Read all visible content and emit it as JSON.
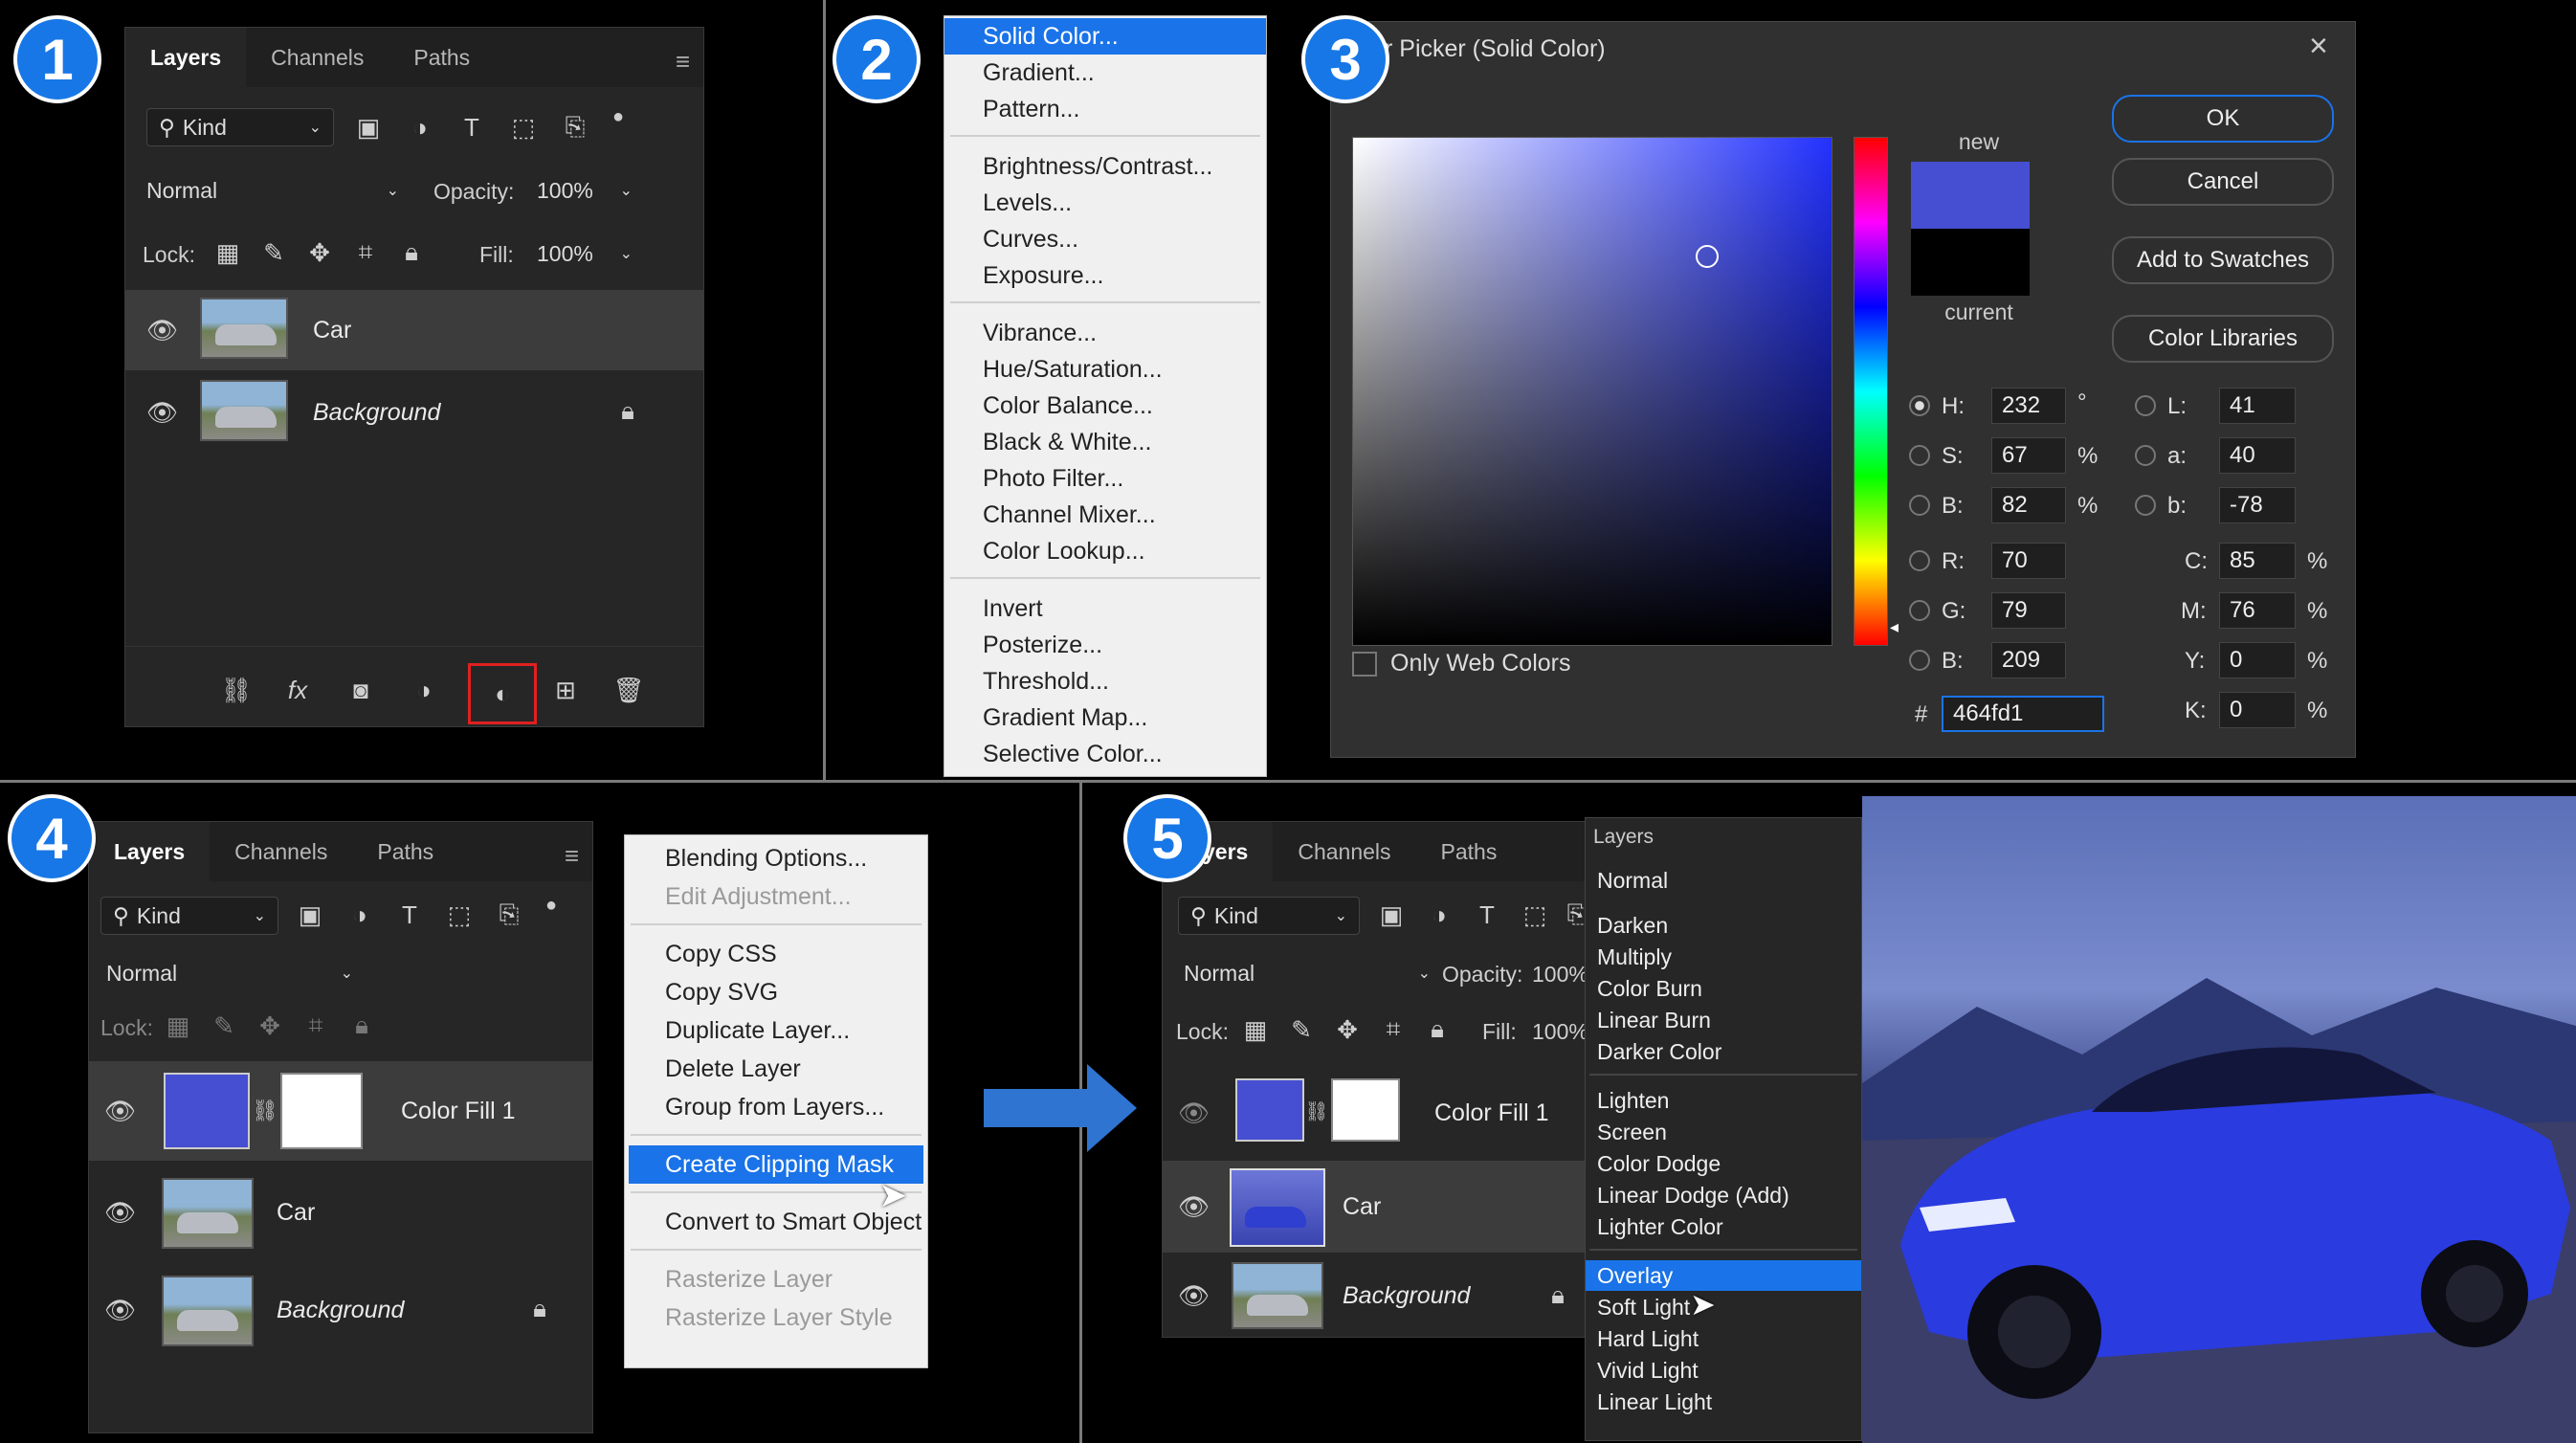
{
  "steps": [
    "1",
    "2",
    "3",
    "4",
    "5"
  ],
  "tabs": {
    "layers": "Layers",
    "channels": "Channels",
    "paths": "Paths"
  },
  "panel": {
    "kind": "Kind",
    "blend": "Normal",
    "opacity_label": "Opacity:",
    "opacity": "100%",
    "lock_label": "Lock:",
    "fill_label": "Fill:",
    "fill": "100%"
  },
  "p1_layers": [
    {
      "name": "Car"
    },
    {
      "name": "Background"
    }
  ],
  "adjust_menu": {
    "groups": [
      [
        "Solid Color...",
        "Gradient...",
        "Pattern..."
      ],
      [
        "Brightness/Contrast...",
        "Levels...",
        "Curves...",
        "Exposure..."
      ],
      [
        "Vibrance...",
        "Hue/Saturation...",
        "Color Balance...",
        "Black & White...",
        "Photo Filter...",
        "Channel Mixer...",
        "Color Lookup..."
      ],
      [
        "Invert",
        "Posterize...",
        "Threshold...",
        "Gradient Map...",
        "Selective Color..."
      ]
    ],
    "selected": "Solid Color..."
  },
  "picker": {
    "title": "r Picker (Solid Color)",
    "new_label": "new",
    "current_label": "current",
    "new_color": "#464fd1",
    "current_color": "#000000",
    "buttons": {
      "ok": "OK",
      "cancel": "Cancel",
      "swatches": "Add to Swatches",
      "libraries": "Color Libraries"
    },
    "only_web": "Only Web Colors",
    "hsb": {
      "H": "232",
      "S": "67",
      "B": "82"
    },
    "rgb": {
      "R": "70",
      "G": "79",
      "B": "209"
    },
    "lab": {
      "L": "41",
      "a": "40",
      "b": "-78"
    },
    "cmyk": {
      "C": "85",
      "M": "76",
      "Y": "0",
      "K": "0"
    },
    "units": {
      "deg": "°",
      "pct": "%"
    },
    "hash": "#",
    "hex": "464fd1"
  },
  "p4_layers": [
    {
      "name": "Color Fill 1"
    },
    {
      "name": "Car"
    },
    {
      "name": "Background"
    }
  ],
  "context_menu": {
    "items": [
      {
        "label": "Blending Options...",
        "disabled": false
      },
      {
        "label": "Edit Adjustment...",
        "disabled": true
      },
      {
        "label": "Copy CSS",
        "disabled": false
      },
      {
        "label": "Copy SVG",
        "disabled": false
      },
      {
        "label": "Duplicate Layer...",
        "disabled": false
      },
      {
        "label": "Delete Layer",
        "disabled": false
      },
      {
        "label": "Group from Layers...",
        "disabled": false
      },
      {
        "label": "Create Clipping Mask",
        "disabled": false,
        "selected": true
      },
      {
        "label": "Convert to Smart Object",
        "disabled": false
      },
      {
        "label": "Rasterize Layer",
        "disabled": true
      },
      {
        "label": "Rasterize Layer Style",
        "disabled": true
      }
    ]
  },
  "p5_tab_partial": "yers",
  "blend_menu": {
    "header": "Layers",
    "current": "Normal",
    "groups": [
      [
        "Darken",
        "Multiply",
        "Color Burn",
        "Linear Burn",
        "Darker Color"
      ],
      [
        "Lighten",
        "Screen",
        "Color Dodge",
        "Linear Dodge (Add)",
        "Lighter Color"
      ],
      [
        "Overlay",
        "Soft Light",
        "Hard Light",
        "Vivid Light",
        "Linear Light"
      ]
    ],
    "selected": "Overlay"
  },
  "colors": {
    "accent": "#1a73e8",
    "fill": "#464fd1",
    "highlight": "#e02020"
  }
}
